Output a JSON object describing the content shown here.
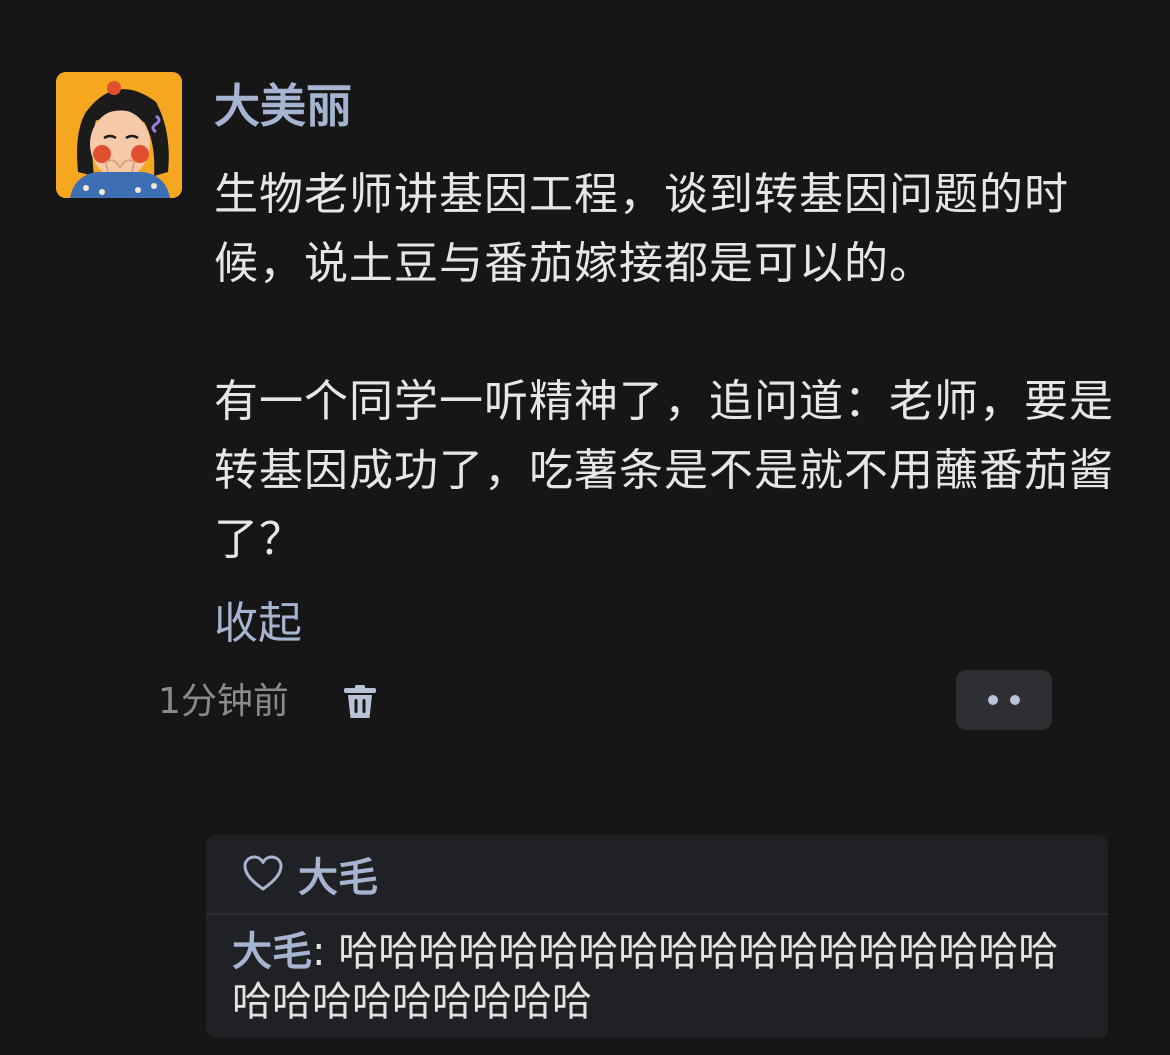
{
  "post": {
    "author": "大美丽",
    "paragraphs": [
      "生物老师讲基因工程，谈到转基因问题的时候，说土豆与番茄嫁接都是可以的。",
      "有一个同学一听精神了，追问道：老师，要是转基因成功了，吃薯条是不是就不用蘸番茄酱了？"
    ],
    "collapse_label": "收起",
    "timestamp": "1分钟前",
    "avatar_icon": "avatar-illustration",
    "delete_icon": "trash-icon",
    "more_icon": "more-dots-icon"
  },
  "reply_section": {
    "liked_by": "大毛",
    "like_icon": "heart-icon",
    "reply": {
      "author": "大毛",
      "separator": ": ",
      "text": "哈哈哈哈哈哈哈哈哈哈哈哈哈哈哈哈哈哈哈哈哈哈哈哈哈哈哈"
    }
  },
  "colors": {
    "background": "#161616",
    "accent_name": "#a5b4d0",
    "body_text": "#e6e6e6",
    "meta_text": "#8a8a8a",
    "panel": "#202124"
  }
}
